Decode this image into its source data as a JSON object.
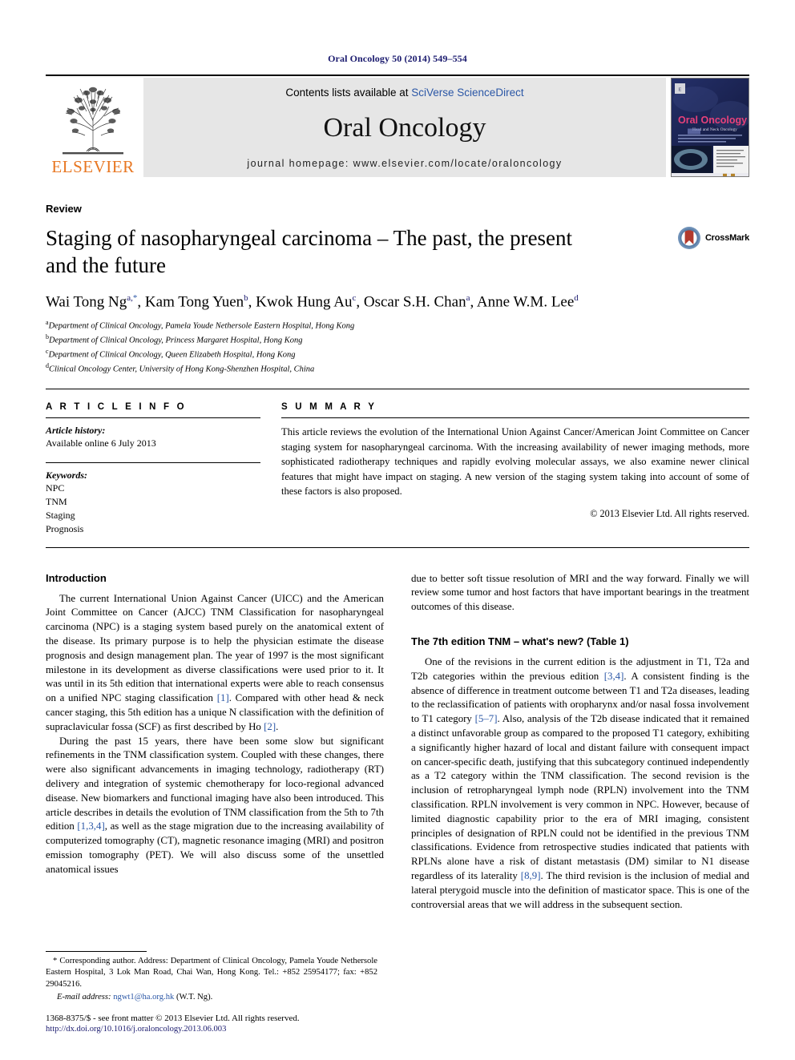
{
  "running_head": "Oral Oncology 50 (2014) 549–554",
  "masthead": {
    "publisher": "ELSEVIER",
    "contents_prefix": "Contents lists available at ",
    "contents_link": "SciVerse ScienceDirect",
    "journal_name": "Oral Oncology",
    "homepage": "journal homepage: www.elsevier.com/locate/oraloncology",
    "cover_title": "Oral Oncology",
    "cover_subtitle": "Head and Neck Oncology"
  },
  "article": {
    "type": "Review",
    "title": "Staging of nasopharyngeal carcinoma – The past, the present and the future",
    "crossmark_label": "CrossMark",
    "authors_html": "Wai Tong Ng<sup class=\"a\">a,</sup><sup class=\"star\">*</sup>, Kam Tong Yuen<sup>b</sup>, Kwok Hung Au<sup>c</sup>, Oscar S.H. Chan<sup>a</sup>, Anne W.M. Lee<sup>d</sup>",
    "affiliations": [
      {
        "marker": "a",
        "text": "Department of Clinical Oncology, Pamela Youde Nethersole Eastern Hospital, Hong Kong"
      },
      {
        "marker": "b",
        "text": "Department of Clinical Oncology, Princess Margaret Hospital, Hong Kong"
      },
      {
        "marker": "c",
        "text": "Department of Clinical Oncology, Queen Elizabeth Hospital, Hong Kong"
      },
      {
        "marker": "d",
        "text": "Clinical Oncology Center, University of Hong Kong-Shenzhen Hospital, China"
      }
    ]
  },
  "article_info": {
    "heading": "A R T I C L E   I N F O",
    "history_label": "Article history:",
    "history_value": "Available online 6 July 2013",
    "keywords_label": "Keywords:",
    "keywords": [
      "NPC",
      "TNM",
      "Staging",
      "Prognosis"
    ]
  },
  "summary": {
    "heading": "S U M M A R Y",
    "text": "This article reviews the evolution of the International Union Against Cancer/American Joint Committee on Cancer staging system for nasopharyngeal carcinoma. With the increasing availability of newer imaging methods, more sophisticated radiotherapy techniques and rapidly evolving molecular assays, we also examine newer clinical features that might have impact on staging. A new version of the staging system taking into account of some of these factors is also proposed.",
    "copyright": "© 2013 Elsevier Ltd. All rights reserved."
  },
  "body": {
    "left_heading": "Introduction",
    "left_p1_html": "The current International Union Against Cancer (UICC) and the American Joint Committee on Cancer (AJCC) TNM Classification for nasopharyngeal carcinoma (NPC) is a staging system based purely on the anatomical extent of the disease. Its primary purpose is to help the physician estimate the disease prognosis and design management plan. The year of 1997 is the most significant milestone in its development as diverse classifications were used prior to it. It was until in its 5th edition that international experts were able to reach consensus on a unified NPC staging classification <span class=\"ref\">[1]</span>. Compared with other head &amp; neck cancer staging, this 5th edition has a unique N classification with the definition of supraclavicular fossa (SCF) as first described by Ho <span class=\"ref\">[2]</span>.",
    "left_p2_html": "During the past 15 years, there have been some slow but significant refinements in the TNM classification system. Coupled with these changes, there were also significant advancements in imaging technology, radiotherapy (RT) delivery and integration of systemic chemotherapy for loco-regional advanced disease. New biomarkers and functional imaging have also been introduced. This article describes in details the evolution of TNM classification from the 5th to 7th edition <span class=\"ref\">[1,3,4]</span>, as well as the stage migration due to the increasing availability of computerized tomography (CT), magnetic resonance imaging (MRI) and positron emission tomography (PET). We will also discuss some of the unsettled anatomical issues",
    "right_p1_html": "due to better soft tissue resolution of MRI and the way forward. Finally we will review some tumor and host factors that have important bearings in the treatment outcomes of this disease.",
    "right_heading": "The 7th edition TNM – what's new? (Table 1)",
    "right_p2_html": "One of the revisions in the current edition is the adjustment in T1, T2a and T2b categories within the previous edition <span class=\"ref\">[3,4]</span>. A consistent finding is the absence of difference in treatment outcome between T1 and T2a diseases, leading to the reclassification of patients with oropharynx and/or nasal fossa involvement to T1 category <span class=\"ref\">[5–7]</span>. Also, analysis of the T2b disease indicated that it remained a distinct unfavorable group as compared to the proposed T1 category, exhibiting a significantly higher hazard of local and distant failure with consequent impact on cancer-specific death, justifying that this subcategory continued independently as a T2 category within the TNM classification. The second revision is the inclusion of retropharyngeal lymph node (RPLN) involvement into the TNM classification. RPLN involvement is very common in NPC. However, because of limited diagnostic capability prior to the era of MRI imaging, consistent principles of designation of RPLN could not be identified in the previous TNM classifications. Evidence from retrospective studies indicated that patients with RPLNs alone have a risk of distant metastasis (DM) similar to N1 disease regardless of its laterality <span class=\"ref\">[8,9]</span>. The third revision is the inclusion of medial and lateral pterygoid muscle into the definition of masticator space. This is one of the controversial areas that we will address in the subsequent section."
  },
  "footnote": {
    "corresponding_html": "* Corresponding author. Address: Department of Clinical Oncology, Pamela Youde Nethersole Eastern Hospital, 3 Lok Man Road, Chai Wan, Hong Kong. Tel.: +852 25954177; fax: +852 29045216.",
    "email_label": "E-mail address:",
    "email": "ngwt1@ha.org.hk",
    "email_owner": "(W.T. Ng)."
  },
  "footer": {
    "issn_line": "1368-8375/$ - see front matter © 2013 Elsevier Ltd. All rights reserved.",
    "doi": "http://dx.doi.org/10.1016/j.oraloncology.2013.06.003"
  },
  "colors": {
    "link": "#2b57a6",
    "navy": "#1a1a6e",
    "elsevier_orange": "#E87722",
    "masthead_gray": "#e6e6e6"
  }
}
